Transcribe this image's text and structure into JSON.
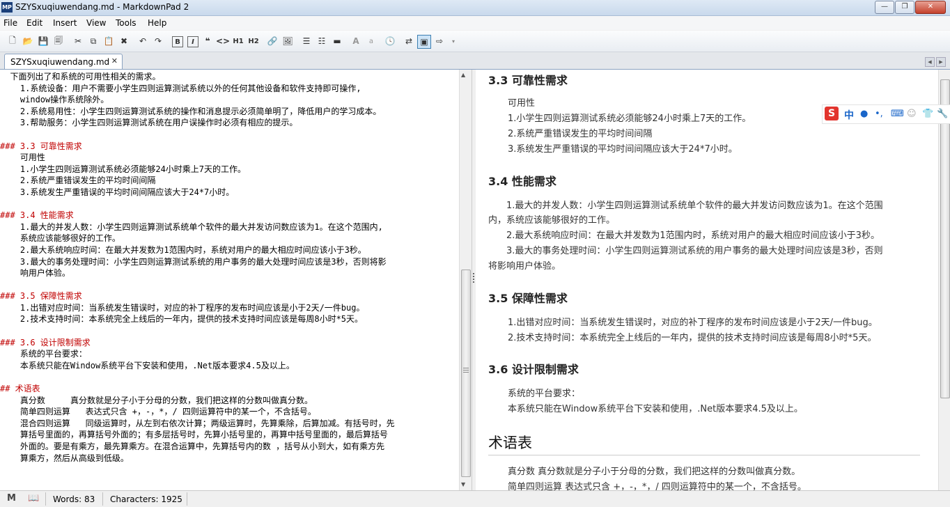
{
  "window": {
    "title": "SZYSxuqiuwendang.md - MarkdownPad 2",
    "app_icon": "MP",
    "controls": [
      "—",
      "❐",
      "✕"
    ]
  },
  "menu": [
    "File",
    "Edit",
    "Insert",
    "View",
    "Tools",
    "Help"
  ],
  "toolbar": {
    "bold": "B",
    "italic": "I",
    "quote": "❝",
    "code": "<>",
    "h1": "H1",
    "h2": "H2",
    "font_large": "A",
    "font_small": "a"
  },
  "tab": {
    "label": "SZYSxuqiuwendang.md",
    "close": "✕"
  },
  "editor": {
    "lines": [
      "  下面列出了和系统的可用性相关的需求。",
      "    1.系统设备：用户不需要小学生四则运算测试系统以外的任何其他设备和软件支持即可操作,",
      "    window操作系统除外。",
      "    2.系统易用性：小学生四则运算测试系统的操作和消息提示必须简单明了，降低用户的学习成本。",
      "    3.帮助服务：小学生四则运算测试系统在用户误操作时必须有相应的提示。",
      "",
      "### 3.3 可靠性需求",
      "    可用性",
      "    1.小学生四则运算测试系统必须能够24小时乘上7天的工作。",
      "    2.系统严重错误发生的平均时间间隔",
      "    3.系统发生严重错误的平均时间间隔应该大于24*7小时。",
      "",
      "### 3.4 性能需求",
      "    1.最大的并发人数：小学生四则运算测试系统单个软件的最大并发访问数应该为1。在这个范围内,",
      "    系统应该能够很好的工作。",
      "    2.最大系统响应时间：在最大并发数为1范围内时，系统对用户的最大相应时间应该小于3秒。",
      "    3.最大的事务处理时间：小学生四则运算测试系统的用户事务的最大处理时间应该是3秒，否则将影",
      "    响用户体验。",
      "",
      "### 3.5 保障性需求",
      "    1.出错对应时间：当系统发生错误时，对应的补丁程序的发布时间应该是小于2天/一件bug。",
      "    2.技术支持时间：本系统完全上线后的一年内，提供的技术支持时间应该是每周8小时*5天。",
      "",
      "### 3.6 设计限制需求",
      "    系统的平台要求：",
      "    本系统只能在Window系统平台下安装和使用，.Net版本要求4.5及以上。",
      "",
      "## 术语表",
      "    真分数     真分数就是分子小于分母的分数，我们把这样的分数叫做真分数。",
      "    简单四则运算   表达式只含 +，-，*，/ 四则运算符中的某一个，不含括号。",
      "    混合四则运算   同级运算时，从左到右依次计算；两级运算时，先算乘除，后算加减。有括号时，先",
      "    算括号里面的，再算括号外面的；有多层括号时，先算小括号里的，再算中括号里面的，最后算括号",
      "    外面的。要是有乘方，最先算乘方。在混合运算中，先算括号内的数 ，括号从小到大，如有乘方先",
      "    算乘方，然后从高级到低级。"
    ]
  },
  "preview": {
    "s33_title": "3.3 可靠性需求",
    "s33_lines": [
      "可用性",
      "1.小学生四则运算测试系统必须能够24小时乘上7天的工作。",
      "2.系统严重错误发生的平均时间间隔",
      "3.系统发生严重错误的平均时间间隔应该大于24*7小时。"
    ],
    "s34_title": "3.4 性能需求",
    "s34_lines": [
      "　　1.最大的并发人数：小学生四则运算测试系统单个软件的最大并发访问数应该为1。在这个范围",
      "内，系统应该能够很好的工作。",
      "　　2.最大系统响应时间：在最大并发数为1范围内时，系统对用户的最大相应时间应该小于3秒。",
      "　　3.最大的事务处理时间：小学生四则运算测试系统的用户事务的最大处理时间应该是3秒，否则",
      "将影响用户体验。"
    ],
    "s35_title": "3.5 保障性需求",
    "s35_lines": [
      "1.出错对应时间：当系统发生错误时，对应的补丁程序的发布时间应该是小于2天/一件bug。",
      "2.技术支持时间：本系统完全上线后的一年内，提供的技术支持时间应该是每周8小时*5天。"
    ],
    "s36_title": "3.6 设计限制需求",
    "s36_lines": [
      "系统的平台要求：",
      "本系统只能在Window系统平台下安装和使用，.Net版本要求4.5及以上。"
    ],
    "glossary_title": "术语表",
    "glossary_lines": [
      "真分数 真分数就是分子小于分母的分数，我们把这样的分数叫做真分数。",
      "简单四则运算 表达式只含 +，-，*，/ 四则运算符中的某一个，不含括号。"
    ]
  },
  "ime": {
    "logo": "S",
    "mode": "中"
  },
  "status": {
    "words": "Words: 83",
    "characters": "Characters: 1925"
  }
}
